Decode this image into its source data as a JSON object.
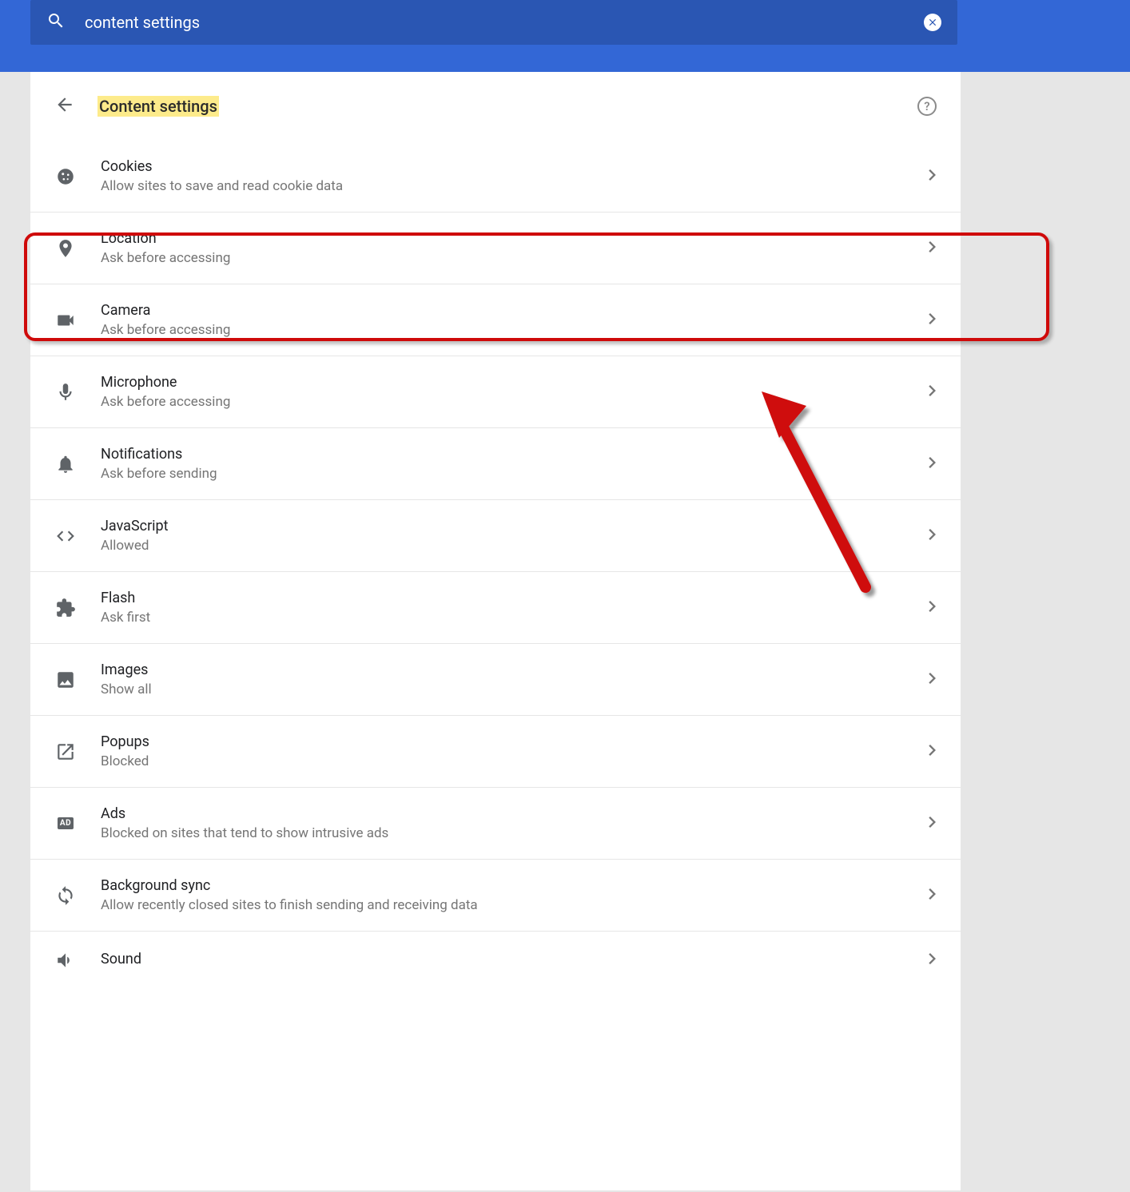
{
  "search": {
    "value": "content settings"
  },
  "page_title": "Content settings",
  "items": [
    {
      "icon": "cookie-icon",
      "title": "Cookies",
      "sub": "Allow sites to save and read cookie data"
    },
    {
      "icon": "location-icon",
      "title": "Location",
      "sub": "Ask before accessing"
    },
    {
      "icon": "camera-icon",
      "title": "Camera",
      "sub": "Ask before accessing"
    },
    {
      "icon": "microphone-icon",
      "title": "Microphone",
      "sub": "Ask before accessing"
    },
    {
      "icon": "bell-icon",
      "title": "Notifications",
      "sub": "Ask before sending"
    },
    {
      "icon": "code-icon",
      "title": "JavaScript",
      "sub": "Allowed"
    },
    {
      "icon": "puzzle-icon",
      "title": "Flash",
      "sub": "Ask first"
    },
    {
      "icon": "image-icon",
      "title": "Images",
      "sub": "Show all"
    },
    {
      "icon": "popup-icon",
      "title": "Popups",
      "sub": "Blocked"
    },
    {
      "icon": "ad-icon",
      "title": "Ads",
      "sub": "Blocked on sites that tend to show intrusive ads"
    },
    {
      "icon": "sync-icon",
      "title": "Background sync",
      "sub": "Allow recently closed sites to finish sending and receiving data"
    },
    {
      "icon": "sound-icon",
      "title": "Sound",
      "sub": ""
    }
  ]
}
